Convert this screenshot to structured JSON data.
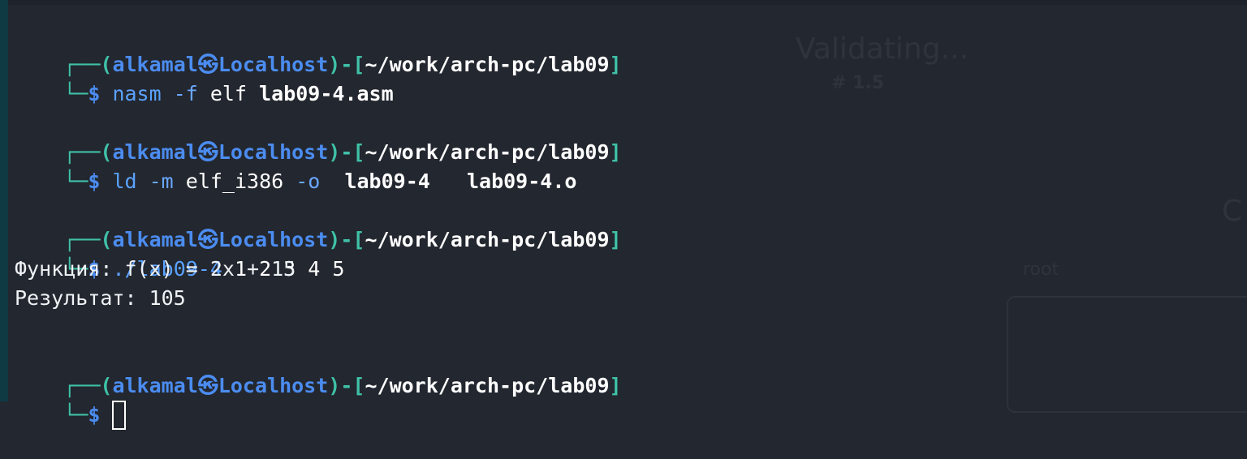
{
  "prompt": {
    "corner_top": "┌──",
    "corner_bottom": "└─",
    "open_paren": "(",
    "close_paren": ")",
    "dash": "-",
    "open_bracket": "[",
    "close_bracket": "]",
    "user": "alkamal",
    "at_symbol": "㉿",
    "host": "Localhost",
    "path": "~/work/arch-pc/lab09",
    "dollar": "$"
  },
  "commands": [
    {
      "cmd": "nasm",
      "args": [
        " -f",
        " elf",
        " lab09-4.asm"
      ]
    },
    {
      "cmd": "ld",
      "args": [
        " -m",
        " elf_i386",
        " -o",
        "  lab09-4",
        "   lab09-4.o"
      ]
    },
    {
      "cmd": "./lab09-4",
      "args": [
        " 1 2 3 4 5"
      ]
    }
  ],
  "output": [
    "Функция: f(x) = 2x + 15",
    "Результат: 105"
  ],
  "background_ghost": {
    "title": "Validating...",
    "version": "# 1.5",
    "letter": "C",
    "root_label": "root"
  },
  "colors": {
    "background": "#23272f",
    "prompt_accent": "#3fc1a8",
    "user_host": "#4b8cf0",
    "command": "#5aa2ff"
  }
}
